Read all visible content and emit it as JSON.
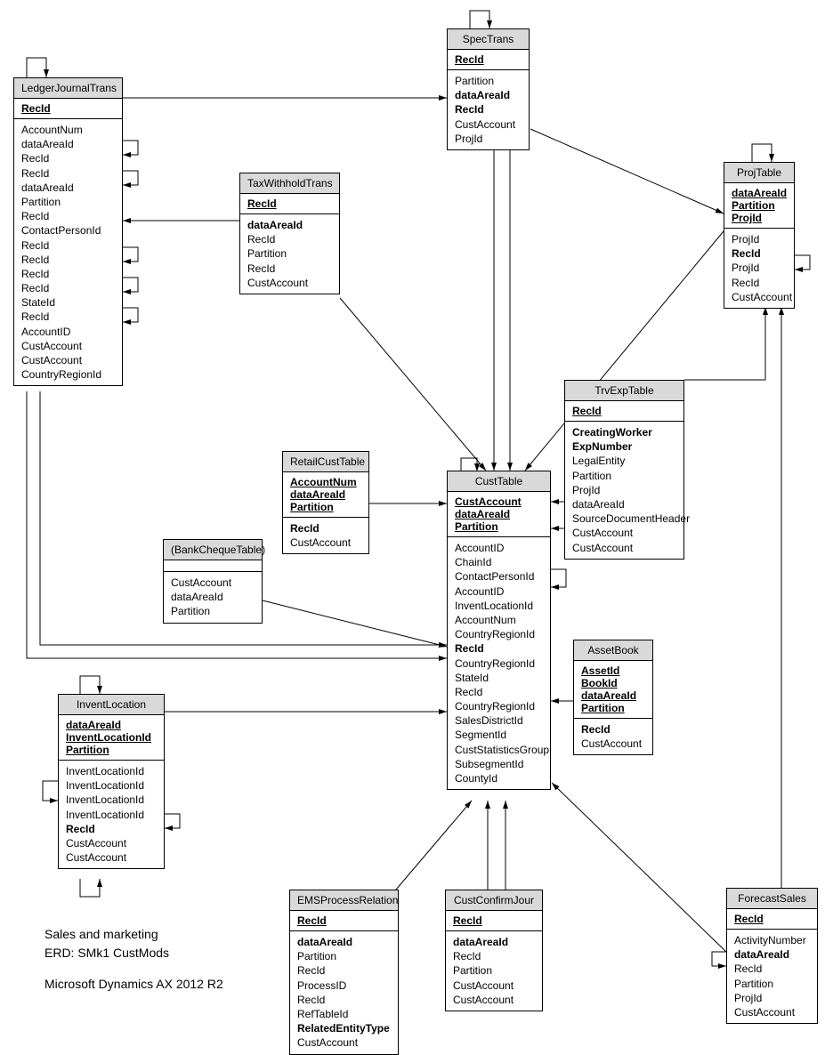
{
  "caption": {
    "line1": "Sales and marketing",
    "line2": "ERD:    SMk1    CustMods",
    "line3": "Microsoft Dynamics AX 2012 R2"
  },
  "entities": {
    "LedgerJournalTrans": {
      "title": "LedgerJournalTrans",
      "pk": [
        "RecId"
      ],
      "attrs": [
        "AccountNum",
        "dataAreaId",
        "RecId",
        "RecId",
        "dataAreaId",
        "Partition",
        "RecId",
        "ContactPersonId",
        "RecId",
        "RecId",
        "RecId",
        "RecId",
        "StateId",
        "RecId",
        "AccountID",
        "CustAccount",
        "CustAccount",
        "CountryRegionId"
      ],
      "bold": []
    },
    "TaxWithholdTrans": {
      "title": "TaxWithholdTrans",
      "pk": [
        "RecId"
      ],
      "attrs": [
        "dataAreaId",
        "RecId",
        "Partition",
        "RecId",
        "CustAccount"
      ],
      "bold": [
        "dataAreaId"
      ]
    },
    "SpecTrans": {
      "title": "SpecTrans",
      "pk": [
        "RecId"
      ],
      "attrs": [
        "Partition",
        "dataAreaId",
        "RecId",
        "CustAccount",
        "ProjId"
      ],
      "bold": [
        "dataAreaId",
        "RecId"
      ]
    },
    "ProjTable": {
      "title": "ProjTable",
      "pk": [
        "dataAreaId",
        "Partition",
        "ProjId"
      ],
      "attrs": [
        "ProjId",
        "RecId",
        "ProjId",
        "RecId",
        "CustAccount"
      ],
      "bold": [
        "RecId"
      ]
    },
    "TrvExpTable": {
      "title": "TrvExpTable",
      "pk": [
        "RecId"
      ],
      "attrs": [
        "CreatingWorker",
        "ExpNumber",
        "LegalEntity",
        "Partition",
        "ProjId",
        "dataAreaId",
        "SourceDocumentHeader",
        "CustAccount",
        "CustAccount"
      ],
      "bold": [
        "CreatingWorker",
        "ExpNumber"
      ]
    },
    "RetailCustTable": {
      "title": "RetailCustTable",
      "pk": [
        "AccountNum",
        "dataAreaId",
        "Partition"
      ],
      "attrs": [
        "RecId",
        "CustAccount"
      ],
      "bold": [
        "RecId"
      ]
    },
    "BankChequeTable": {
      "title": "(BankChequeTable)",
      "pk": [],
      "attrs": [
        "CustAccount",
        "dataAreaId",
        "Partition"
      ],
      "bold": []
    },
    "CustTable": {
      "title": "CustTable",
      "pk": [
        "CustAccount",
        "dataAreaId",
        "Partition"
      ],
      "attrs": [
        "AccountID",
        "ChainId",
        "ContactPersonId",
        "AccountID",
        "InventLocationId",
        "AccountNum",
        "CountryRegionId",
        "RecId",
        "CountryRegionId",
        "StateId",
        "RecId",
        "CountryRegionId",
        "SalesDistrictId",
        "SegmentId",
        "CustStatisticsGroup",
        "SubsegmentId",
        "CountyId"
      ],
      "bold": [
        "RecId"
      ]
    },
    "AssetBook": {
      "title": "AssetBook",
      "pk": [
        "AssetId",
        "BookId",
        "dataAreaId",
        "Partition"
      ],
      "attrs": [
        "RecId",
        "CustAccount"
      ],
      "bold": [
        "RecId"
      ]
    },
    "InventLocation": {
      "title": "InventLocation",
      "pk": [
        "dataAreaId",
        "InventLocationId",
        "Partition"
      ],
      "attrs": [
        "InventLocationId",
        "InventLocationId",
        "InventLocationId",
        "InventLocationId",
        "RecId",
        "CustAccount",
        "CustAccount"
      ],
      "bold": [
        "RecId"
      ]
    },
    "EMSProcessRelation": {
      "title": "EMSProcessRelation",
      "pk": [
        "RecId"
      ],
      "attrs": [
        "dataAreaId",
        "Partition",
        "RecId",
        "ProcessID",
        "RecId",
        "RefTableId",
        "RelatedEntityType",
        "CustAccount"
      ],
      "bold": [
        "dataAreaId",
        "RelatedEntityType"
      ]
    },
    "CustConfirmJour": {
      "title": "CustConfirmJour",
      "pk": [
        "RecId"
      ],
      "attrs": [
        "dataAreaId",
        "RecId",
        "Partition",
        "CustAccount",
        "CustAccount"
      ],
      "bold": [
        "dataAreaId"
      ]
    },
    "ForecastSales": {
      "title": "ForecastSales",
      "pk": [
        "RecId"
      ],
      "attrs": [
        "ActivityNumber",
        "dataAreaId",
        "RecId",
        "Partition",
        "ProjId",
        "CustAccount"
      ],
      "bold": [
        "dataAreaId"
      ]
    }
  }
}
